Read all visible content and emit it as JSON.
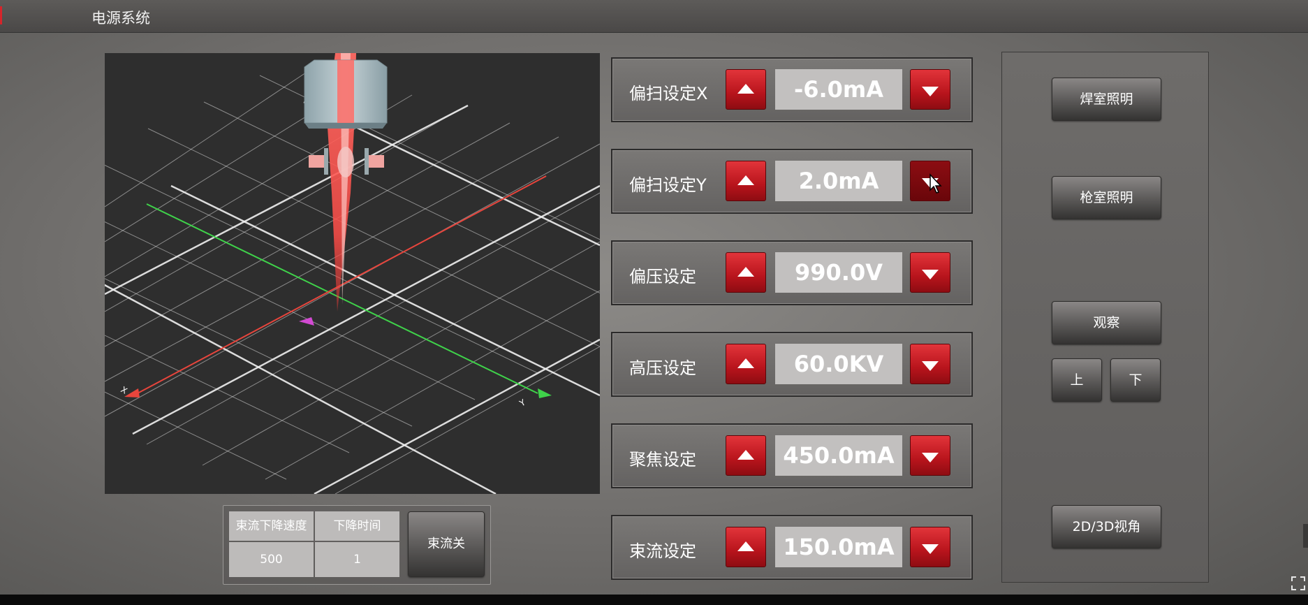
{
  "window": {
    "title": "电源系统"
  },
  "settings": [
    {
      "label": "偏扫设定X",
      "value": "-6.0mA"
    },
    {
      "label": "偏扫设定Y",
      "value": "2.0mA"
    },
    {
      "label": "偏压设定",
      "value": "990.0V"
    },
    {
      "label": "高压设定",
      "value": "60.0KV"
    },
    {
      "label": "聚焦设定",
      "value": "450.0mA"
    },
    {
      "label": "束流设定",
      "value": "150.0mA"
    }
  ],
  "beam_panel": {
    "speed_label": "束流下降速度",
    "speed_value": "500",
    "time_label": "下降时间",
    "time_value": "1",
    "toggle_button": "束流关"
  },
  "right_panel": {
    "weld_light": "焊室照明",
    "gun_light": "枪室照明",
    "observe": "观察",
    "up": "上",
    "down": "下",
    "view_toggle": "2D/3D视角"
  },
  "colors": {
    "accent_red": "#d6252b",
    "x_axis": "#e8453c",
    "y_axis": "#3fd24a",
    "beam": "#ff5a55"
  },
  "icons": {
    "increase": "triangle-up-icon",
    "decrease": "triangle-down-icon",
    "cursor": "mouse-pointer-icon",
    "fullscreen": "expand-icon"
  }
}
